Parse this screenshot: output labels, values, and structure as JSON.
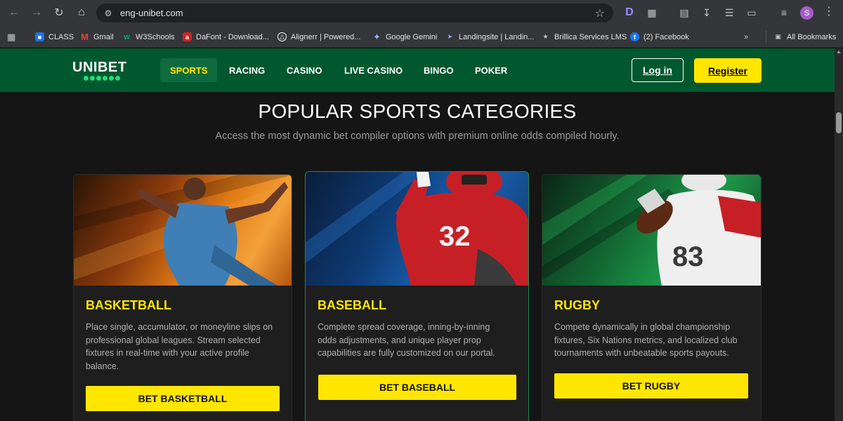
{
  "browser": {
    "url": "eng-unibet.com",
    "profile_initial": "S",
    "bookmarks": [
      {
        "label": "CLASS",
        "icon": "google-classroom-icon",
        "color": "#1a73e8"
      },
      {
        "label": "Gmail",
        "icon": "gmail-icon",
        "color": "#ea4335"
      },
      {
        "label": "W3Schools",
        "icon": "w3schools-icon",
        "color": "#04aa6d"
      },
      {
        "label": "DaFont - Download...",
        "icon": "dafont-icon",
        "color": "#c62828"
      },
      {
        "label": "Alignerr | Powered...",
        "icon": "alignerr-icon",
        "color": "#ffffff"
      },
      {
        "label": "Google Gemini",
        "icon": "gemini-icon",
        "color": "#8ab4f8"
      },
      {
        "label": "Landingsite | Landin...",
        "icon": "landingsite-icon",
        "color": "#8ab4f8"
      },
      {
        "label": "Brillica Services LMS",
        "icon": "brillica-icon",
        "color": "#9aa0a6"
      },
      {
        "label": "(2) Facebook",
        "icon": "facebook-icon",
        "color": "#1877f2"
      }
    ],
    "all_bookmarks": "All Bookmarks"
  },
  "site": {
    "logo": "UNIBET",
    "nav": [
      "SPORTS",
      "RACING",
      "CASINO",
      "LIVE CASINO",
      "BINGO",
      "POKER"
    ],
    "active_nav": "SPORTS",
    "login": "Log in",
    "register": "Register",
    "brand_green": "#00582f",
    "accent_yellow": "#ffe600"
  },
  "section": {
    "title": "POPULAR SPORTS CATEGORIES",
    "subtitle": "Access the most dynamic bet compiler options with premium online odds compiled hourly."
  },
  "cards": [
    {
      "title": "BASKETBALL",
      "description": "Place single, accumulator, or moneyline slips on professional global leagues. Stream selected fixtures in real-time with your active profile balance.",
      "button": "BET BASKETBALL"
    },
    {
      "title": "BASEBALL",
      "description": "Complete spread coverage, inning-by-inning odds adjustments, and unique player prop capabilities are fully customized on our portal.",
      "button": "BET BASEBALL"
    },
    {
      "title": "RUGBY",
      "description": "Compete dynamically in global championship fixtures, Six Nations metrics, and localized club tournaments with unbeatable sports payouts.",
      "button": "BET RUGBY"
    }
  ]
}
